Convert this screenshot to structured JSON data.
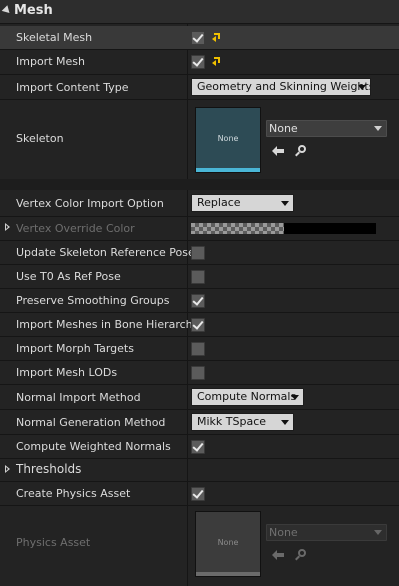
{
  "section": {
    "title": "Mesh"
  },
  "rows": {
    "skeletal_mesh": {
      "label": "Skeletal Mesh",
      "checked": true
    },
    "import_mesh": {
      "label": "Import Mesh",
      "checked": true
    },
    "import_content_type": {
      "label": "Import Content Type",
      "value": "Geometry and Skinning Weights"
    },
    "skeleton": {
      "label": "Skeleton",
      "thumb_text": "None",
      "combo_value": "None"
    },
    "vertex_color_import_option": {
      "label": "Vertex Color Import Option",
      "value": "Replace"
    },
    "vertex_override_color": {
      "label": "Vertex Override Color"
    },
    "update_skeleton_ref_pose": {
      "label": "Update Skeleton Reference Pose",
      "checked": false
    },
    "use_t0_as_ref_pose": {
      "label": "Use T0 As Ref Pose",
      "checked": false
    },
    "preserve_smoothing_groups": {
      "label": "Preserve Smoothing Groups",
      "checked": true
    },
    "import_meshes_in_bone_hierarchy": {
      "label": "Import Meshes in Bone Hierarchy",
      "checked": true
    },
    "import_morph_targets": {
      "label": "Import Morph Targets",
      "checked": false
    },
    "import_mesh_lods": {
      "label": "Import Mesh LODs",
      "checked": false
    },
    "normal_import_method": {
      "label": "Normal Import Method",
      "value": "Compute Normals"
    },
    "normal_generation_method": {
      "label": "Normal Generation Method",
      "value": "Mikk TSpace"
    },
    "compute_weighted_normals": {
      "label": "Compute Weighted Normals",
      "checked": true
    },
    "thresholds": {
      "label": "Thresholds"
    },
    "create_physics_asset": {
      "label": "Create Physics Asset",
      "checked": true
    },
    "physics_asset": {
      "label": "Physics Asset",
      "thumb_text": "None",
      "combo_value": "None"
    }
  },
  "icons": {
    "section_expander": "expanded-arrow-icon",
    "reset": "reset-to-default-icon",
    "back": "use-selected-arrow-icon",
    "find": "browse-magnifier-icon",
    "subgroup_expander": "collapsed-arrow-icon"
  },
  "colors": {
    "background": "#232323",
    "highlight_row": "#393939",
    "combo": "#d6d6d6",
    "checkbox": "#5b5b5b",
    "reset_arrow": "#f0c000",
    "skeleton_thumb": "#2d4b55",
    "skeleton_thumb_bar": "#4ab6d6",
    "physics_thumb": "#3c3c3c",
    "physics_thumb_bar": "#6b6b6b"
  }
}
